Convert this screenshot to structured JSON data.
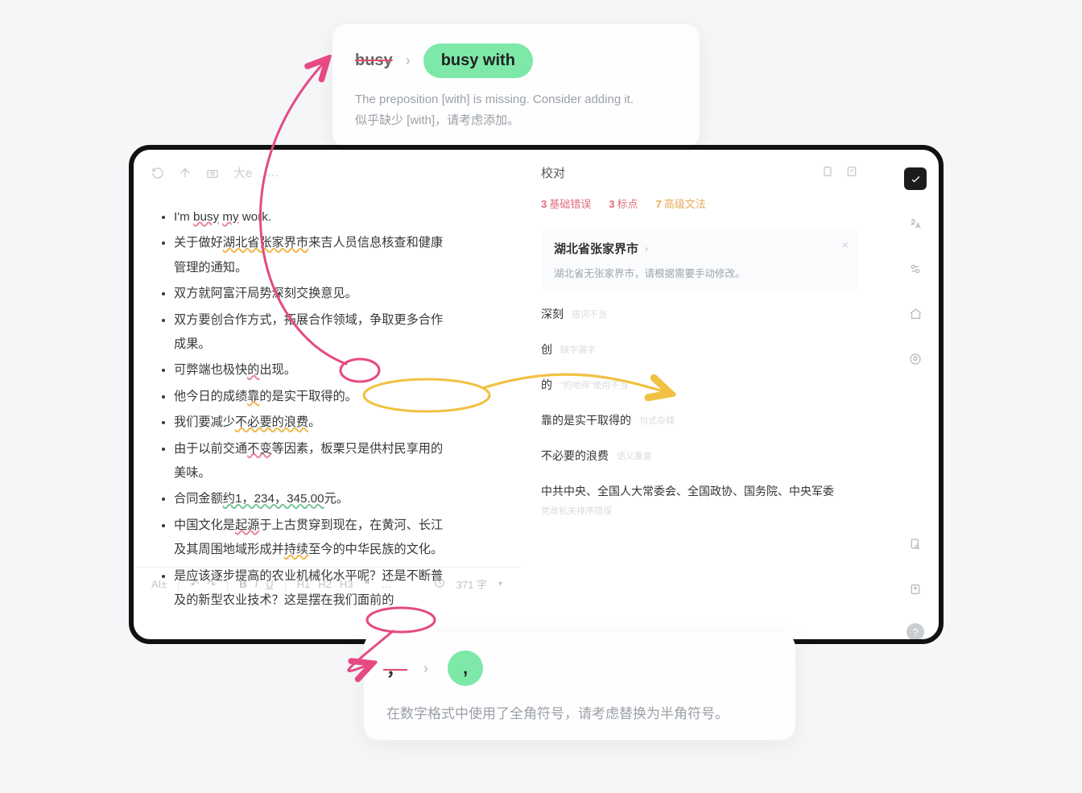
{
  "calloutTop": {
    "wrong": "busy",
    "right": "busy with",
    "en": "The preposition [with] is missing. Consider adding it.",
    "zh": "似乎缺少 [with]，请考虑添加。"
  },
  "calloutBot": {
    "wrong": "，",
    "right": ",",
    "msg": "在数字格式中使用了全角符号，请考虑替换为半角符号。"
  },
  "toolbar": {
    "sizeLabel": "大e",
    "more": "…"
  },
  "doc": {
    "li0_a": "I'm ",
    "li0_busy": "busy",
    "li0_b": " ",
    "li0_my": "my",
    "li0_c": " work.",
    "li1_a": "关于做好",
    "li1_hl": "湖北省张家界市",
    "li1_b": "来吉人员信息核查和健康管理的通知。",
    "li2": "双方就阿富汗局势深刻交换意见。",
    "li3": "双方要创合作方式，拓展合作领域，争取更多合作成果。",
    "li4_a": "可弊端也极快",
    "li4_de": "的",
    "li4_b": "出现。",
    "li5_a": "他今日的成绩",
    "li5_kao": "靠",
    "li5_b": "的是实干取得的。",
    "li6_a": "我们要减少",
    "li6_hl": "不必要的浪费",
    "li6_b": "。",
    "li7_a": "由于以前交通",
    "li7_bu": "不变",
    "li7_b": "等因素，板栗只是供村民享用的美味。",
    "li8_a": "合同金额",
    "li8_hl": "约1，234，345.00",
    "li8_b": "元。",
    "li9_a": "中国文化是",
    "li9_qy": "起源",
    "li9_b": "于上古贯穿到现在，在黄河、长江及其周围地域形成并",
    "li9_cx": "持续",
    "li9_c": "至今的中华民族的文化。",
    "li10": "是应该逐步提高的农业机械化水平呢？还是不断普及的新型农业技术？这是摆在我们面前的"
  },
  "editbar": {
    "ai": "AI±",
    "b": "B",
    "i": "I",
    "u": "U",
    "h1": "H1",
    "h2": "H2",
    "h3": "H3",
    "q": "❝",
    "more": "…",
    "count": "371 字"
  },
  "rightPanel": {
    "title": "校对",
    "filters": {
      "c1": "3",
      "t1": "基础错误",
      "c2": "3",
      "t2": "标点",
      "c3": "7",
      "t3": "高级文法"
    },
    "detail": {
      "title": "湖北省张家界市",
      "sub": "湖北省无张家界市，请根据需要手动修改。"
    },
    "issues": {
      "i1": {
        "k": "深刻",
        "h": "搭词不当"
      },
      "i2": {
        "k": "创",
        "h": "缺字漏字"
      },
      "i3": {
        "k": "的",
        "h": "“的地得”使用不当"
      },
      "i4": {
        "k": "靠的是实干取得的",
        "h": "句式杂糅"
      },
      "i5": {
        "k": "不必要的浪费",
        "h": "语义重复"
      },
      "i6": {
        "k": "中共中央、全国人大常委会、全国政协、国务院、中央军委",
        "h": "党政机关排序错误"
      }
    }
  },
  "sidebar": {
    "help": "?"
  }
}
